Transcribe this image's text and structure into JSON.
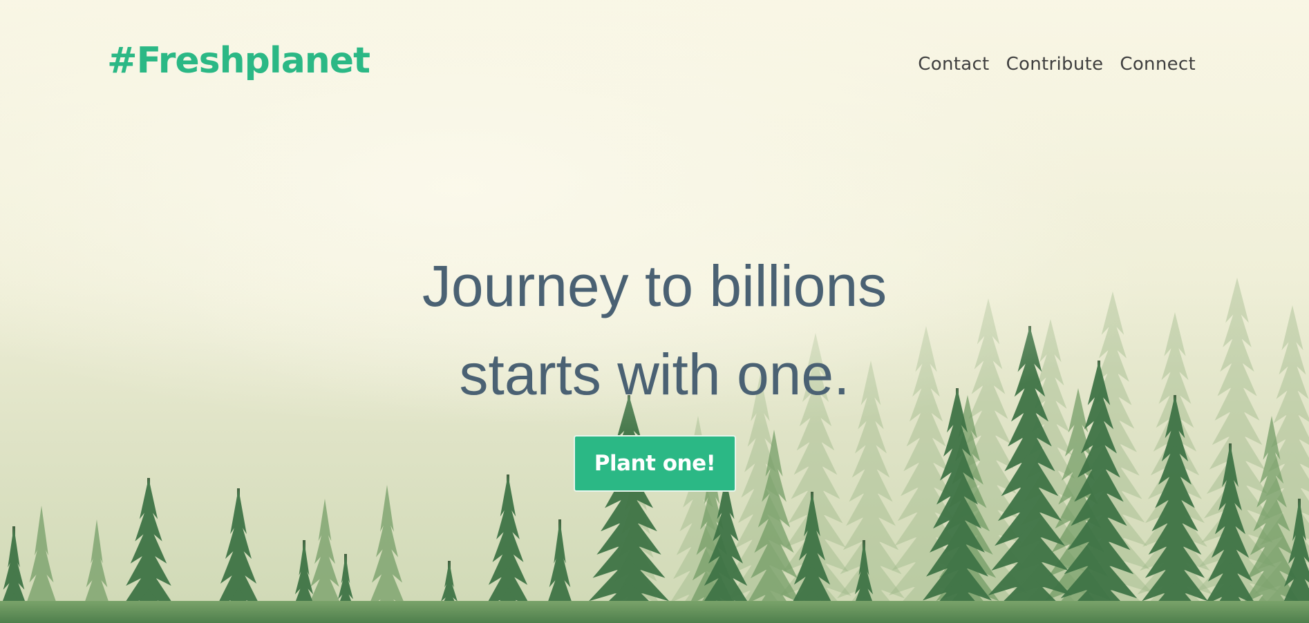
{
  "header": {
    "logo": "#Freshplanet",
    "nav": [
      "Contact",
      "Contribute",
      "Connect"
    ]
  },
  "hero": {
    "headline_line1": "Journey to billions",
    "headline_line2": "starts with one.",
    "cta_label": "Plant one!"
  },
  "theme": {
    "brand_green": "#2bb885",
    "headline_color": "#4a6173",
    "nav_color": "#3e3e3e"
  }
}
